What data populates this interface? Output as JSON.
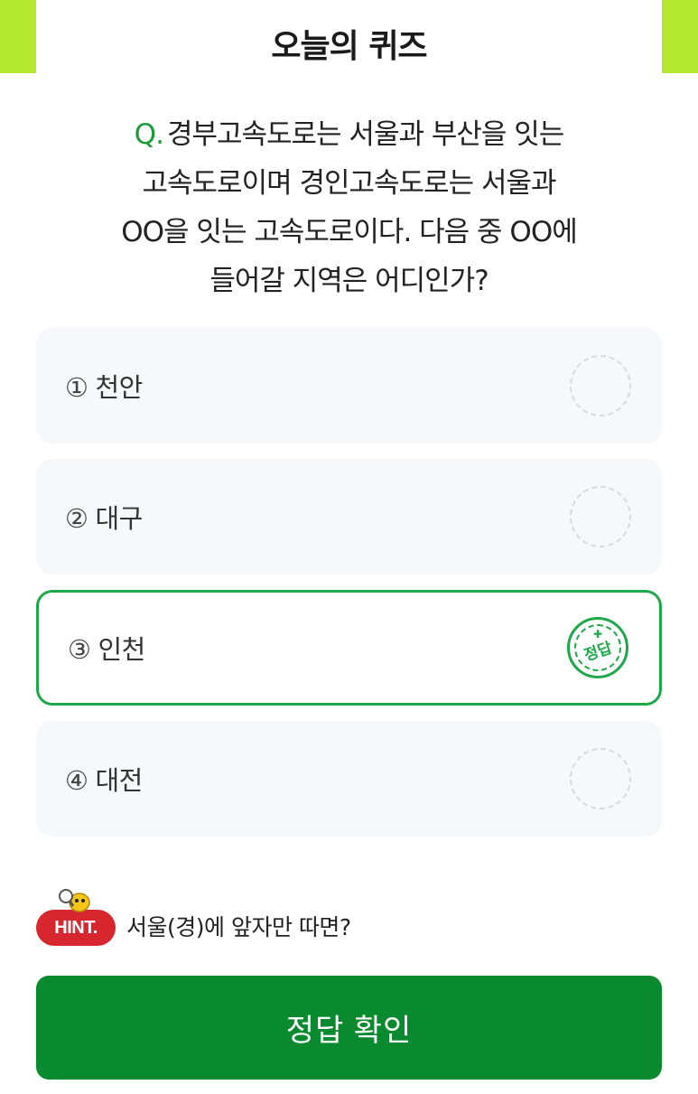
{
  "header": {
    "title": "오늘의 퀴즈"
  },
  "question": {
    "prefix": "Q.",
    "line1": "경부고속도로는 서울과 부산을 잇는",
    "line2": "고속도로이며 경인고속도로는 서울과",
    "line3": "OO을 잇는 고속도로이다. 다음 중 OO에",
    "line4": "들어갈 지역은 어디인가?"
  },
  "options": [
    {
      "num": "①",
      "label": "천안",
      "state": "unselected"
    },
    {
      "num": "②",
      "label": "대구",
      "state": "unselected"
    },
    {
      "num": "③",
      "label": "인천",
      "state": "correct",
      "badge_text": "정답"
    },
    {
      "num": "④",
      "label": "대전",
      "state": "unselected"
    }
  ],
  "hint": {
    "badge_label": "HINT.",
    "text": "서울(경)에 앞자만 따면?"
  },
  "confirm_button": {
    "label": "정답 확인"
  },
  "colors": {
    "accent_lime": "#b3e82f",
    "correct_green": "#1fa84a",
    "button_green": "#0a8a2e",
    "hint_red": "#d8262e",
    "option_bg": "#f7f8fb"
  }
}
